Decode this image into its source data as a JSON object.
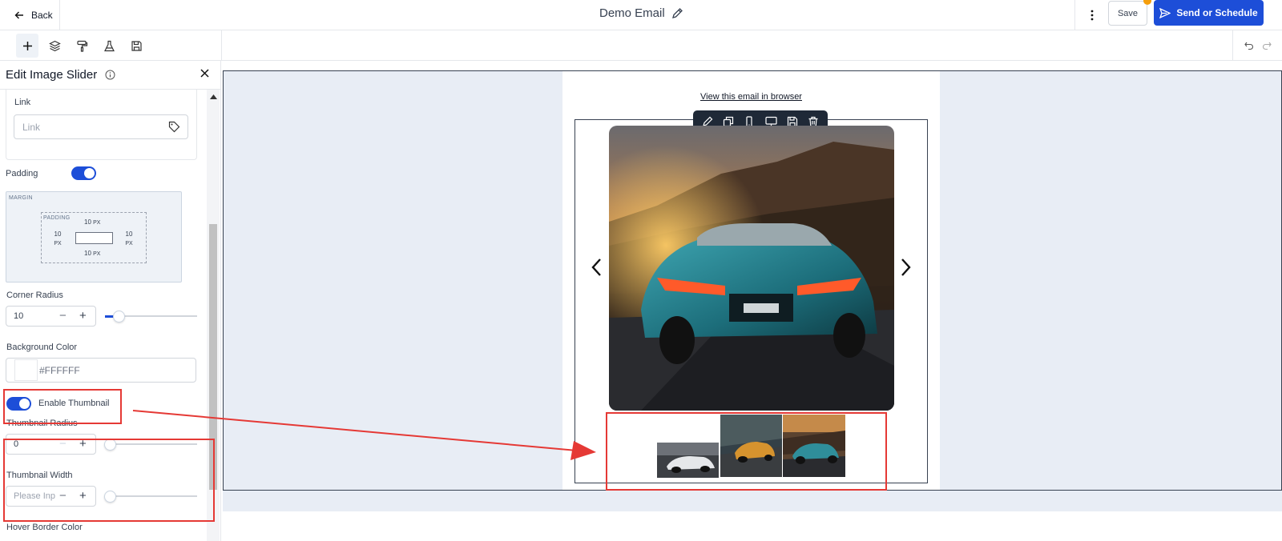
{
  "header": {
    "back_label": "Back",
    "title": "Demo Email",
    "save_label": "Save",
    "send_label": "Send or Schedule"
  },
  "panel": {
    "title": "Edit Image Slider",
    "link_label": "Link",
    "link_placeholder": "Link",
    "padding_label": "Padding",
    "padding_enabled": true,
    "box": {
      "margin_label": "MARGIN",
      "padding_label": "PADDING",
      "top": "10",
      "bottom": "10",
      "left": "10",
      "right": "10",
      "unit": "PX"
    },
    "corner_radius": {
      "label": "Corner Radius",
      "value": "10",
      "slider_fraction": 0.15
    },
    "background_color": {
      "label": "Background Color",
      "value": "#FFFFFF"
    },
    "enable_thumbnail": {
      "label": "Enable Thumbnail",
      "enabled": true
    },
    "thumbnail_radius": {
      "label": "Thumbnail Radius",
      "value": "0",
      "slider_fraction": 0
    },
    "thumbnail_width": {
      "label": "Thumbnail Width",
      "placeholder": "Please Inp",
      "slider_fraction": 0
    },
    "hover_border_color": {
      "label": "Hover Border Color"
    }
  },
  "email": {
    "view_in_browser": "View this email in browser"
  },
  "colors": {
    "primary": "#1d4ed8",
    "highlight": "#e53935",
    "canvas": "#e8edf5"
  }
}
